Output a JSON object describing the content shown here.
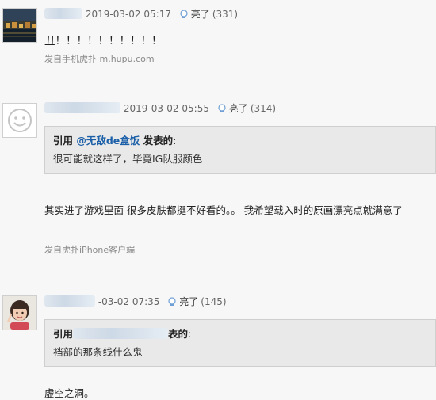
{
  "posts": [
    {
      "timestamp": "2019-03-02 05:17",
      "like_label": "亮了",
      "like_count": "(331)",
      "content": "丑！！！！！！！！！！",
      "source": "发自手机虎扑 m.hupu.com"
    },
    {
      "timestamp": "2019-03-02 05:55",
      "like_label": "亮了",
      "like_count": "(314)",
      "quote": {
        "prefix": "引用 ",
        "user": "@无敌de盒饭",
        "suffix": " 发表的",
        "colon": ":",
        "body": "很可能就这样了，毕竟IG队服颜色"
      },
      "content": "其实进了游戏里面 很多皮肤都挺不好看的。。 我希望载入时的原画漂亮点就满意了",
      "source": "发自虎扑iPhone客户端"
    },
    {
      "timestamp": "-03-02 07:35",
      "like_label": "亮了",
      "like_count": "(145)",
      "quote": {
        "prefix": "引用",
        "suffix": "表的",
        "colon": ":",
        "body": "裆部的那条线什么鬼"
      },
      "content": "虚空之洞。"
    }
  ],
  "colors": {
    "background": "#f7f7f7",
    "quote_bg": "#e9e9e9",
    "username_link": "#1a5fa8"
  }
}
